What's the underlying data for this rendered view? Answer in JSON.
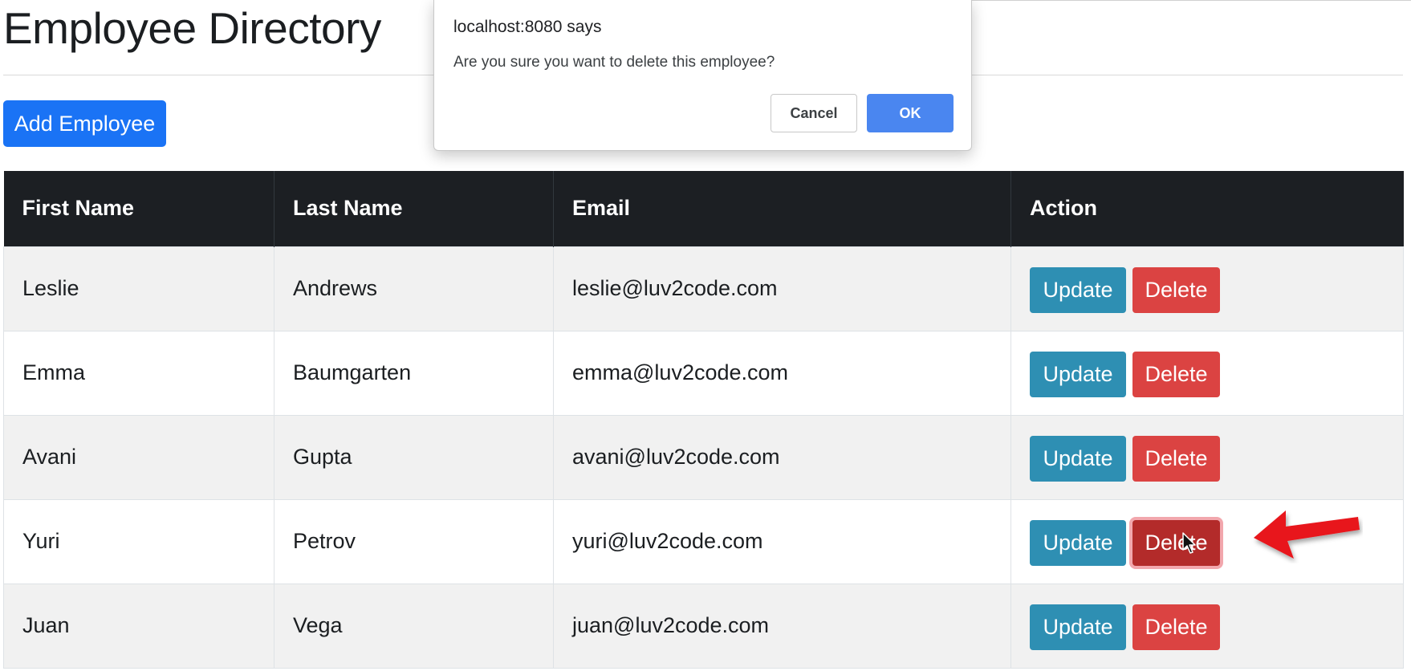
{
  "page": {
    "title": "Employee Directory",
    "add_button_label": "Add Employee"
  },
  "table": {
    "headers": [
      "First Name",
      "Last Name",
      "Email",
      "Action"
    ],
    "rows": [
      {
        "first_name": "Leslie",
        "last_name": "Andrews",
        "email": "leslie@luv2code.com",
        "update_label": "Update",
        "delete_label": "Delete"
      },
      {
        "first_name": "Emma",
        "last_name": "Baumgarten",
        "email": "emma@luv2code.com",
        "update_label": "Update",
        "delete_label": "Delete"
      },
      {
        "first_name": "Avani",
        "last_name": "Gupta",
        "email": "avani@luv2code.com",
        "update_label": "Update",
        "delete_label": "Delete"
      },
      {
        "first_name": "Yuri",
        "last_name": "Petrov",
        "email": "yuri@luv2code.com",
        "update_label": "Update",
        "delete_label": "Delete"
      },
      {
        "first_name": "Juan",
        "last_name": "Vega",
        "email": "juan@luv2code.com",
        "update_label": "Update",
        "delete_label": "Delete"
      }
    ],
    "hovered_delete_row": 3
  },
  "dialog": {
    "origin": "localhost:8080 says",
    "message": "Are you sure you want to delete this employee?",
    "cancel_label": "Cancel",
    "ok_label": "OK"
  },
  "icons": {
    "cursor": "mouse-pointer-icon",
    "annotation": "red-arrow-icon"
  },
  "colors": {
    "primary": "#1a73f5",
    "header_bg": "#1c1f23",
    "update": "#2e8fb3",
    "delete": "#db4342",
    "delete_hover": "#b32b2a",
    "dialog_ok": "#4a86f0",
    "annotation": "#e8131a"
  }
}
